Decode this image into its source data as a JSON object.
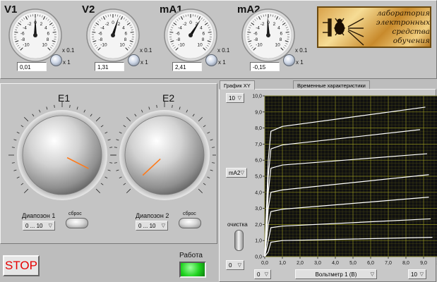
{
  "meters": [
    {
      "id": "v1",
      "title": "V1",
      "readout": "0,01",
      "value": 0.01,
      "range_labels": [
        "x 0.1",
        "x 1"
      ]
    },
    {
      "id": "v2",
      "title": "V2",
      "readout": "1,31",
      "value": 1.31,
      "range_labels": [
        "x 0.1",
        "x 1"
      ]
    },
    {
      "id": "ma1",
      "title": "mA1",
      "readout": "2,41",
      "value": 2.41,
      "range_labels": [
        "x 0.1",
        "x 1"
      ]
    },
    {
      "id": "ma2",
      "title": "mA2",
      "readout": "-0,15",
      "value": -0.15,
      "range_labels": [
        "x 0.1",
        "x 1"
      ]
    }
  ],
  "meter_ticks": [
    "-10",
    "-8",
    "-6",
    "-4",
    "-2",
    "0",
    "2",
    "4",
    "6",
    "8",
    "10"
  ],
  "logo": {
    "lines": [
      "лаборатория",
      "электронных",
      "средства",
      "обучения"
    ]
  },
  "sources": [
    {
      "id": "e1",
      "title": "E1",
      "range_label": "Диапозон 1",
      "range_value": "0 ... 10",
      "reset_label": "сброс",
      "pointer_deg": 117
    },
    {
      "id": "e2",
      "title": "E2",
      "range_label": "Диапозон 2",
      "range_value": "0 ... 10",
      "reset_label": "сброс",
      "pointer_deg": 227
    }
  ],
  "stop_label": "STOP",
  "run": {
    "label": "Работа",
    "color": "#1ed21e"
  },
  "tabs": [
    "График XY",
    "Временные характеристики"
  ],
  "graph": {
    "y_max_select": "10",
    "y_min_select": "0",
    "y_channel": "mA2",
    "x_min_select": "0",
    "x_max_select": "10",
    "x_channel": "Вольтметр 1 (В)",
    "clear_label": "очистка",
    "plot_bg": "#101010",
    "grid_color": "#9a9a20",
    "trace_color": "#ffffff"
  },
  "chart_data": {
    "type": "line",
    "xlabel": "Вольтметр 1 (В)",
    "ylabel": "",
    "xlim": [
      0,
      10
    ],
    "ylim": [
      0,
      10
    ],
    "x_ticks": [
      "0,0",
      "1,0",
      "2,0",
      "3,0",
      "4,0",
      "5,0",
      "6,0",
      "7,0",
      "8,0",
      "9,0",
      "10,0"
    ],
    "y_ticks": [
      "0,0",
      "1,0",
      "2,0",
      "3,0",
      "4,0",
      "5,0",
      "6,0",
      "7,0",
      "8,0",
      "9,0",
      "10,0"
    ],
    "grid": true,
    "series": [
      {
        "values": [
          [
            0,
            0
          ],
          [
            0.2,
            0.3
          ],
          [
            0.35,
            0.9
          ],
          [
            1,
            1.0
          ],
          [
            9.5,
            1.2
          ]
        ]
      },
      {
        "values": [
          [
            0,
            0
          ],
          [
            0.2,
            1.0
          ],
          [
            0.35,
            1.8
          ],
          [
            1,
            1.9
          ],
          [
            9.4,
            2.35
          ]
        ]
      },
      {
        "values": [
          [
            0,
            0
          ],
          [
            0.2,
            2.0
          ],
          [
            0.35,
            2.8
          ],
          [
            1,
            2.95
          ],
          [
            9.3,
            3.7
          ]
        ]
      },
      {
        "values": [
          [
            0,
            0
          ],
          [
            0.2,
            3.0
          ],
          [
            0.35,
            4.0
          ],
          [
            1,
            4.15
          ],
          [
            9.3,
            5.1
          ]
        ]
      },
      {
        "values": [
          [
            0,
            0
          ],
          [
            0.2,
            4.0
          ],
          [
            0.35,
            5.5
          ],
          [
            1,
            5.7
          ],
          [
            9.2,
            6.4
          ]
        ]
      },
      {
        "values": [
          [
            0,
            0
          ],
          [
            0.2,
            5.0
          ],
          [
            0.35,
            6.7
          ],
          [
            1,
            6.95
          ],
          [
            8.8,
            7.9
          ]
        ]
      },
      {
        "values": [
          [
            0,
            0
          ],
          [
            0.2,
            6.0
          ],
          [
            0.35,
            7.8
          ],
          [
            1,
            8.1
          ],
          [
            9.1,
            9.3
          ]
        ]
      }
    ]
  }
}
